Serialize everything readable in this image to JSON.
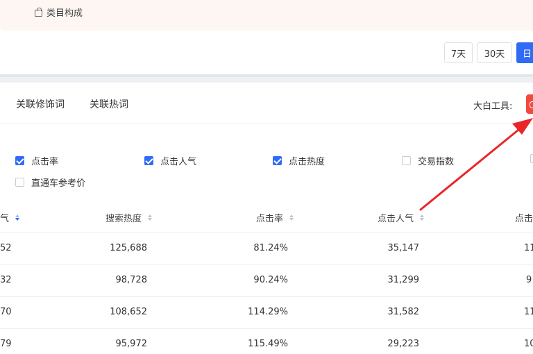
{
  "banner": {
    "category_label": "类目构成"
  },
  "date_range": {
    "btn_7": "7天",
    "btn_30": "30天",
    "btn_active": "日"
  },
  "tabs": {
    "related_modifiers": "关联修饰词",
    "related_hot": "关联热词"
  },
  "tool": {
    "label": "大白工具:"
  },
  "filters": [
    {
      "label": "点击率",
      "checked": true
    },
    {
      "label": "点击人气",
      "checked": true
    },
    {
      "label": "点击热度",
      "checked": true
    },
    {
      "label": "交易指数",
      "checked": false
    },
    {
      "label": "直通车参考价",
      "checked": false
    }
  ],
  "table": {
    "headers": [
      "气",
      "搜索热度",
      "点击率",
      "点击人气",
      "点击"
    ],
    "rows": [
      [
        "52",
        "125,688",
        "81.24%",
        "35,147",
        "11"
      ],
      [
        "32",
        "98,728",
        "90.24%",
        "31,299",
        "9"
      ],
      [
        "70",
        "108,652",
        "114.29%",
        "31,582",
        "11"
      ],
      [
        "79",
        "95,972",
        "115.49%",
        "29,223",
        "10"
      ]
    ]
  },
  "colors": {
    "accent": "#2f6bf5",
    "tool_red": "#f04a3e",
    "arrow_red": "#e8262a",
    "banner_bg": "#fdf6f2"
  },
  "icons": {
    "banner": "shopping-bag-icon",
    "sort": "sort-caret-icon",
    "check": "checkmark-icon"
  }
}
